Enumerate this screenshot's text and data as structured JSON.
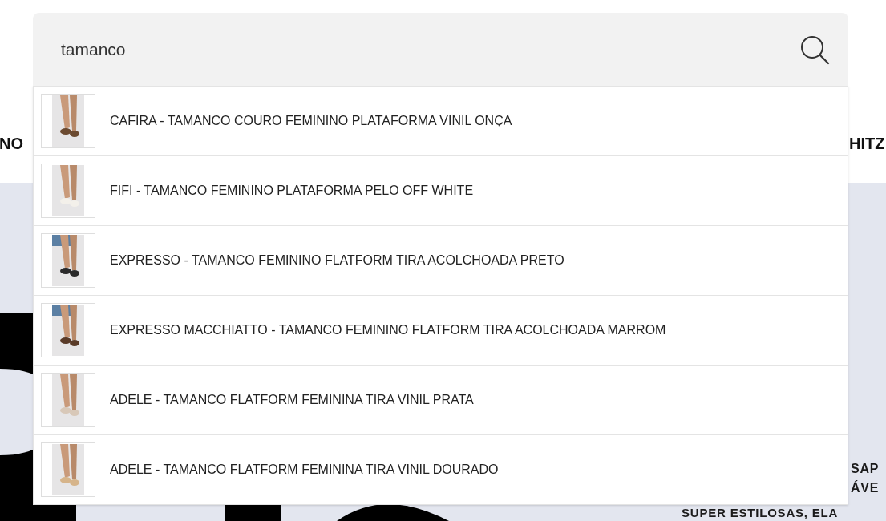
{
  "search": {
    "value": "tamanco"
  },
  "nav": [
    {
      "label": "NO"
    },
    {
      "label": "HITZ"
    }
  ],
  "banner": {
    "lines": [
      "SAP",
      "ÁVE",
      "SUPER ESTILOSAS, ELA"
    ]
  },
  "suggestions": [
    {
      "title": "CAFIRA - TAMANCO COURO FEMININO PLATAFORMA VINIL ONÇA"
    },
    {
      "title": "FIFI - TAMANCO FEMININO PLATAFORMA PELO OFF WHITE"
    },
    {
      "title": "EXPRESSO - TAMANCO FEMININO FLATFORM TIRA ACOLCHOADA PRETO"
    },
    {
      "title": "EXPRESSO MACCHIATTO - TAMANCO FEMININO FLATFORM TIRA ACOLCHOADA MARROM"
    },
    {
      "title": "ADELE - TAMANCO FLATFORM FEMININA TIRA VINIL PRATA"
    },
    {
      "title": "ADELE - TAMANCO FLATFORM FEMININA TIRA VINIL DOURADO"
    }
  ]
}
